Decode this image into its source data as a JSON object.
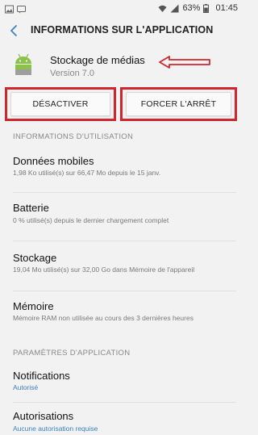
{
  "status_bar": {
    "battery_percent": "63%",
    "time": "01:45",
    "icons": [
      "image-icon",
      "message-icon",
      "wifi-icon",
      "signal-icon",
      "battery-icon"
    ]
  },
  "header": {
    "title": "INFORMATIONS SUR L'APPLICATION"
  },
  "app": {
    "name": "Stockage de médias",
    "version": "Version 7.0"
  },
  "buttons": {
    "disable": "DÉSACTIVER",
    "force_stop": "FORCER L'ARRÊT"
  },
  "usage_section": {
    "label": "INFORMATIONS D'UTILISATION",
    "items": [
      {
        "title": "Données mobiles",
        "subtitle": "1,98 Ko utilisé(s) sur 66,47 Mo depuis le 15 janv."
      },
      {
        "title": "Batterie",
        "subtitle": "0 % utilisé(s) depuis le dernier chargement complet"
      },
      {
        "title": "Stockage",
        "subtitle": "19,04 Mo utilisé(s) sur 32,00 Go dans Mémoire de l'appareil"
      },
      {
        "title": "Mémoire",
        "subtitle": "Mémoire RAM non utilisée au cours des 3 dernières heures"
      }
    ]
  },
  "settings_section": {
    "label": "PARAMÈTRES D'APPLICATION",
    "items": [
      {
        "title": "Notifications",
        "subtitle": "Autorisé"
      },
      {
        "title": "Autorisations",
        "subtitle": "Aucune autorisation requise"
      }
    ]
  },
  "colors": {
    "accent_blue": "#3d82c4",
    "annotation_red": "#d0262d",
    "android_green": "#8bc34a"
  }
}
